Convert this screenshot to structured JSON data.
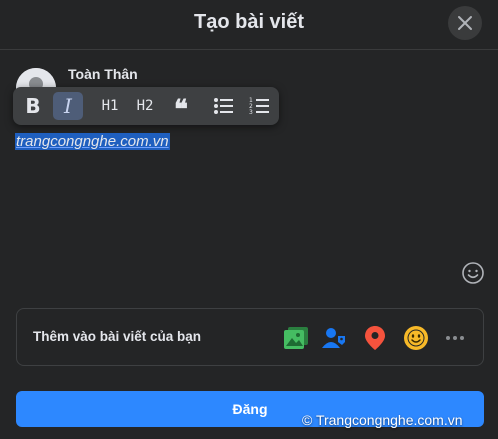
{
  "header": {
    "title": "Tạo bài viết",
    "close_icon": "close-icon"
  },
  "user": {
    "name": "Toàn Thân",
    "avatar_icon": "avatar"
  },
  "toolbar": {
    "bold_label": "B",
    "italic_label": "I",
    "h1_label": "H1",
    "h2_label": "H2",
    "quote_label": "❝",
    "bullet_list_icon": "bullet-list-icon",
    "numbered_list_icon": "numbered-list-icon",
    "active": "italic"
  },
  "editor": {
    "content": "trangcongnghe.com.vn",
    "emoji_icon": "emoji-icon"
  },
  "add_to_post": {
    "label": "Thêm vào bài viết của bạn",
    "icons": [
      "photo-icon",
      "tag-people-icon",
      "location-icon",
      "feeling-icon",
      "more-icon"
    ]
  },
  "post_button": {
    "label": "Đăng"
  },
  "watermark": {
    "text": "© Trangcongnghe.com.vn"
  },
  "colors": {
    "background": "#242526",
    "accent": "#2d88ff",
    "selection": "#1f5fbf"
  }
}
